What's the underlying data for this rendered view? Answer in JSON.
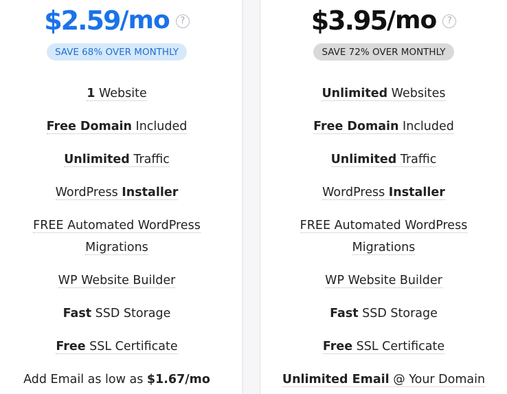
{
  "plans": [
    {
      "price": "$2.59",
      "per": "/mo",
      "help_icon": "?",
      "badge": "SAVE 68% OVER MONTHLY",
      "accent": "#1a73e8",
      "badge_bg": "#d6e9fb",
      "badge_color": "#1f6fd1",
      "features": [
        {
          "bold": "1",
          "text": " Website"
        },
        {
          "bold": "Free Domain",
          "text": " Included"
        },
        {
          "bold": "Unlimited",
          "text": " Traffic"
        },
        {
          "pre": "WordPress ",
          "bold": "Installer"
        },
        {
          "line1": "FREE Automated WordPress",
          "line2": "Migrations"
        },
        {
          "pre": "WP Website Builder"
        },
        {
          "bold": "Fast",
          "text": " SSD Storage"
        },
        {
          "bold": "Free",
          "text": " SSL Certificate"
        },
        {
          "pre": "Add Email as low as ",
          "bold": "$1.67",
          "post": "/mo"
        }
      ]
    },
    {
      "price": "$3.95",
      "per": "/mo",
      "help_icon": "?",
      "badge": "SAVE 72% OVER MONTHLY",
      "accent": "#111111",
      "badge_bg": "#d9d9d9",
      "badge_color": "#222222",
      "features": [
        {
          "bold": "Unlimited",
          "text": " Websites"
        },
        {
          "bold": "Free Domain",
          "text": " Included"
        },
        {
          "bold": "Unlimited",
          "text": " Traffic"
        },
        {
          "pre": "WordPress ",
          "bold": "Installer"
        },
        {
          "line1": "FREE Automated WordPress",
          "line2": "Migrations"
        },
        {
          "pre": "WP Website Builder"
        },
        {
          "bold": "Fast",
          "text": " SSD Storage"
        },
        {
          "bold": "Free",
          "text": " SSL Certificate"
        },
        {
          "bold": "Unlimited Email",
          "text": " @ Your Domain"
        }
      ]
    }
  ]
}
